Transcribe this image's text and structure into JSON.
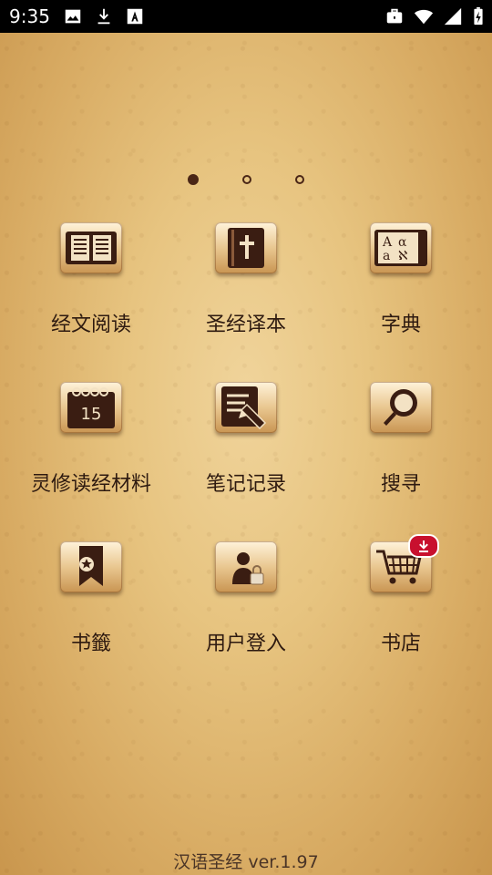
{
  "status_bar": {
    "time": "9:35",
    "left_icons": [
      "image-icon",
      "download-icon",
      "font-a-icon"
    ],
    "right_icons": [
      "briefcase-icon",
      "wifi-icon",
      "signal-icon",
      "battery-charging-icon"
    ]
  },
  "pager": {
    "pages": 3,
    "active_index": 0
  },
  "menu": [
    {
      "label": "经文阅读",
      "icon": "open-book-icon"
    },
    {
      "label": "圣经译本",
      "icon": "bible-cross-icon"
    },
    {
      "label": "字典",
      "icon": "dictionary-icon"
    },
    {
      "label": "灵修读经材料",
      "icon": "calendar-15-icon"
    },
    {
      "label": "笔记记录",
      "icon": "notepad-pencil-icon"
    },
    {
      "label": "搜寻",
      "icon": "magnifier-icon"
    },
    {
      "label": "书籤",
      "icon": "bookmark-icon"
    },
    {
      "label": "用户登入",
      "icon": "user-lock-icon"
    },
    {
      "label": "书店",
      "icon": "shopping-cart-icon"
    }
  ],
  "footer": {
    "text": "汉语圣经 ver.1.97"
  },
  "colors": {
    "icon_dark": "#3a1d12",
    "accent_red": "#c8102e",
    "text": "#2e1a10"
  }
}
